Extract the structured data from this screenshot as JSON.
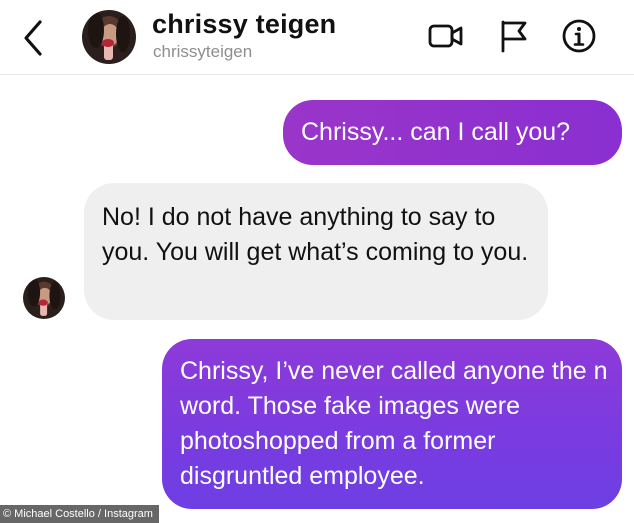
{
  "header": {
    "display_name": "chrissy teigen",
    "username": "chrissyteigen",
    "icons": {
      "back": "chevron-left-icon",
      "video": "video-camera-icon",
      "flag": "flag-icon",
      "info": "info-icon"
    }
  },
  "messages": [
    {
      "direction": "sent",
      "text": "Chrissy... can I call you?"
    },
    {
      "direction": "received",
      "text": "No! I do not have anything to say to you. You will get what’s coming to you."
    },
    {
      "direction": "sent",
      "text": "Chrissy, I’ve never called anyone the n word. Those fake images were photoshopped from a former disgruntled employee."
    }
  ],
  "credit": "© Michael Costello / Instagram",
  "colors": {
    "sent_bubble": "#8a2fd1",
    "received_bubble": "#efefef",
    "handle_text": "#8e8e8e"
  }
}
